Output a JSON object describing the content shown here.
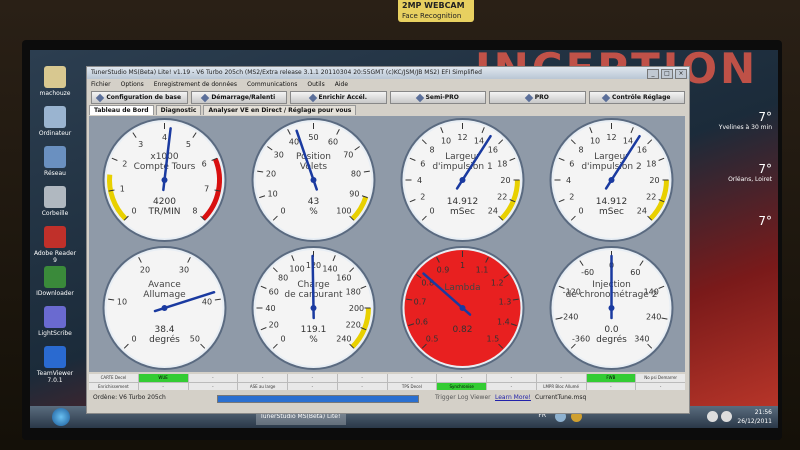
{
  "webcam": {
    "title": "2MP WEBCAM",
    "subtitle": "Face Recognition"
  },
  "wall_text": "INCEPTION",
  "desktop_icons": [
    {
      "label": "machouze",
      "color": "#d8c890"
    },
    {
      "label": "Ordinateur",
      "color": "#9ab4d0"
    },
    {
      "label": "Réseau",
      "color": "#6a90c0"
    },
    {
      "label": "Corbeille",
      "color": "#b0b8c0"
    },
    {
      "label": "Adobe Reader 9",
      "color": "#c0302a"
    },
    {
      "label": "IDownloader",
      "color": "#3a8a3a"
    },
    {
      "label": "LightScribe",
      "color": "#6a6ad0"
    },
    {
      "label": "TeamViewer 7.0.1",
      "color": "#2a6ad0"
    }
  ],
  "widgets": [
    {
      "temp": "7°",
      "text": "Yvelines à 30 min"
    },
    {
      "temp": "7°",
      "text": "Orléans, Loiret"
    },
    {
      "temp": "7°",
      "text": ""
    }
  ],
  "app": {
    "title": "TunerStudio MS(Beta) Lite! v1.19 - V6 Turbo 205ch (MS2/Extra release 3.1.1 20110304 20:55GMT (c)KC/JSM/JB MS2) EFI Simplified",
    "menu": [
      "Fichier",
      "Options",
      "Enregistrement de données",
      "Communications",
      "Outils",
      "Aide"
    ],
    "toolbar": [
      "Configuration de base",
      "Démarrage/Ralenti",
      "Enrichir Accél.",
      "Semi-PRO",
      "PRO",
      "Contrôle Réglage"
    ],
    "tabs": [
      "Tableau de Bord",
      "Diagnostic",
      "Analyser VE en Direct / Réglage pour vous"
    ],
    "status_cells": [
      "CARTE Decel",
      "WUE",
      "-",
      "-",
      "-",
      "-",
      "-",
      "-",
      "-",
      "-",
      "FWB",
      "No psi Demarrer",
      "Enrichissement",
      "-",
      "-",
      "ASE au large",
      "-",
      "-",
      "TPS Decel",
      "Synchronise",
      "-",
      "LMPR Bloc Allumé",
      "-",
      "-"
    ],
    "status_on": [
      1,
      10,
      19
    ],
    "bottom": {
      "left": "Ordène: V6 Turbo 205ch",
      "progress": 1.0,
      "log": "Trigger Log Viewer",
      "learn": "Learn More!",
      "tune": "CurrentTune.msq"
    }
  },
  "gauges": [
    {
      "name": "tachometer",
      "title": [
        "x1000",
        "Compte Tours"
      ],
      "value": "4200",
      "unit": "TR/MIN",
      "min": 0,
      "max": 8,
      "labels": [
        "0",
        "1",
        "2",
        "3",
        "4",
        "5",
        "6",
        "7",
        "8"
      ],
      "needle": 4.2,
      "face": "#f4f4f4",
      "warn": {
        "yellow": [
          0,
          1.5
        ],
        "red": [
          6,
          8
        ]
      }
    },
    {
      "name": "throttle-position",
      "title": [
        "Position",
        "Volets"
      ],
      "value": "43",
      "unit": "%",
      "min": 0,
      "max": 100,
      "labels": [
        "0",
        "10",
        "20",
        "30",
        "40",
        "50",
        "60",
        "70",
        "80",
        "90",
        "100"
      ],
      "needle": 43,
      "face": "#f4f4f4",
      "warn": {
        "yellow": [
          90,
          100
        ]
      }
    },
    {
      "name": "pulse-width-1",
      "title": [
        "Largeur",
        "d'impulsion 1"
      ],
      "value": "14.912",
      "unit": "mSec",
      "min": 0,
      "max": 24,
      "labels": [
        "0",
        "2",
        "4",
        "6",
        "8",
        "10",
        "12",
        "14",
        "16",
        "18",
        "20",
        "22",
        "24"
      ],
      "needle": 14.9,
      "face": "#f4f4f4",
      "warn": {
        "yellow": [
          20,
          24
        ]
      }
    },
    {
      "name": "pulse-width-2",
      "title": [
        "Largeur",
        "d'impulsion 2"
      ],
      "value": "14.912",
      "unit": "mSec",
      "min": 0,
      "max": 24,
      "labels": [
        "0",
        "2",
        "4",
        "6",
        "8",
        "10",
        "12",
        "14",
        "16",
        "18",
        "20",
        "22",
        "24"
      ],
      "needle": 14.9,
      "face": "#f4f4f4",
      "warn": {
        "yellow": [
          20,
          24
        ]
      }
    },
    {
      "name": "ignition-advance",
      "title": [
        "Avance",
        "Allumage"
      ],
      "value": "38.4",
      "unit": "degrés",
      "min": 0,
      "max": 50,
      "labels": [
        "0",
        "10",
        "20",
        "30",
        "40",
        "50"
      ],
      "needle": 38.4,
      "face": "#f4f4f4",
      "warn": {}
    },
    {
      "name": "fuel-load",
      "title": [
        "Charge",
        "de carburant"
      ],
      "value": "119.1",
      "unit": "%",
      "min": 0,
      "max": 240,
      "labels": [
        "0",
        "20",
        "40",
        "60",
        "80",
        "100",
        "120",
        "140",
        "160",
        "180",
        "200",
        "220",
        "240"
      ],
      "needle": 119.1,
      "face": "#f4f4f4",
      "warn": {
        "yellow": [
          200,
          240
        ]
      }
    },
    {
      "name": "lambda",
      "title": [
        "Lambda"
      ],
      "value": "0.82",
      "unit": "",
      "min": 0.5,
      "max": 1.5,
      "labels": [
        "0.5",
        "0.6",
        "0.7",
        "0.8",
        "0.9",
        "1",
        "1.1",
        "1.2",
        "1.3",
        "1.4",
        "1.5"
      ],
      "needle": 0.82,
      "face": "#e82020",
      "warn": {}
    },
    {
      "name": "injection-timing",
      "title": [
        "Injection",
        "de chronométrage 2"
      ],
      "value": "0.0",
      "unit": "degrés",
      "min": -360,
      "max": 360,
      "labels": [
        "-360",
        "-240",
        "-120",
        "-60",
        "0",
        "60",
        "140",
        "240",
        "340"
      ],
      "needle": 0,
      "face": "#f4f4f4",
      "warn": {}
    }
  ]
}
